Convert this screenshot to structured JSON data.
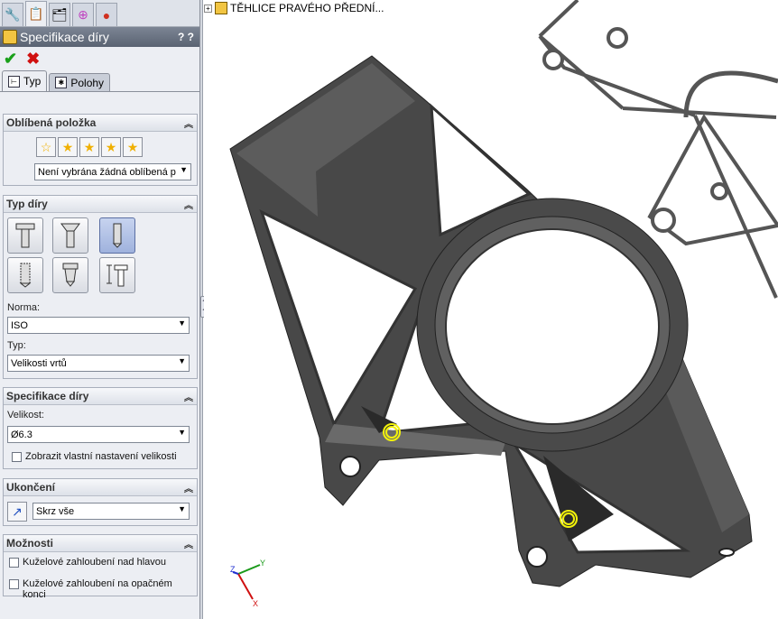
{
  "manager_tabs": [
    "featuremanager-icon",
    "propertymanager-icon",
    "configurationmanager-icon",
    "dimxpert-icon",
    "display-manager-icon"
  ],
  "header": {
    "title": "Specifikace díry",
    "help": "? ?"
  },
  "actions": {
    "ok": "✔",
    "cancel": "✖"
  },
  "tabs": [
    {
      "label": "Typ"
    },
    {
      "label": "Polohy"
    }
  ],
  "favorites": {
    "title": "Oblíbená položka",
    "selected": "Není vybrána žádná oblíbená p"
  },
  "hole_type": {
    "title": "Typ díry",
    "buttons": [
      "counterbore-icon",
      "countersink-icon",
      "simple-hole-icon",
      "tapped-hole-icon",
      "pipe-tap-icon",
      "legacy-hole-icon"
    ],
    "standard_label": "Norma:",
    "standard_value": "ISO",
    "type_label": "Typ:",
    "type_value": "Velikosti vrtů"
  },
  "hole_spec": {
    "title": "Specifikace díry",
    "size_label": "Velikost:",
    "size_value": "Ø6.3",
    "custom_size_label": "Zobrazit vlastní nastavení velikosti"
  },
  "end_condition": {
    "title": "Ukončení",
    "value": "Skrz vše"
  },
  "options": {
    "title": "Možnosti",
    "items": [
      "Kuželové zahloubení nad hlavou",
      "Kuželové zahloubení na opačném konci"
    ]
  },
  "tree": {
    "root_label": "TĚHLICE PRAVÉHO PŘEDNÍ..."
  },
  "triad": {
    "x": "X",
    "y": "Y",
    "z": "Z"
  },
  "colors": {
    "part_fill": "#3c3c3c",
    "part_top": "#555555",
    "highlight": "#f2f20a"
  }
}
